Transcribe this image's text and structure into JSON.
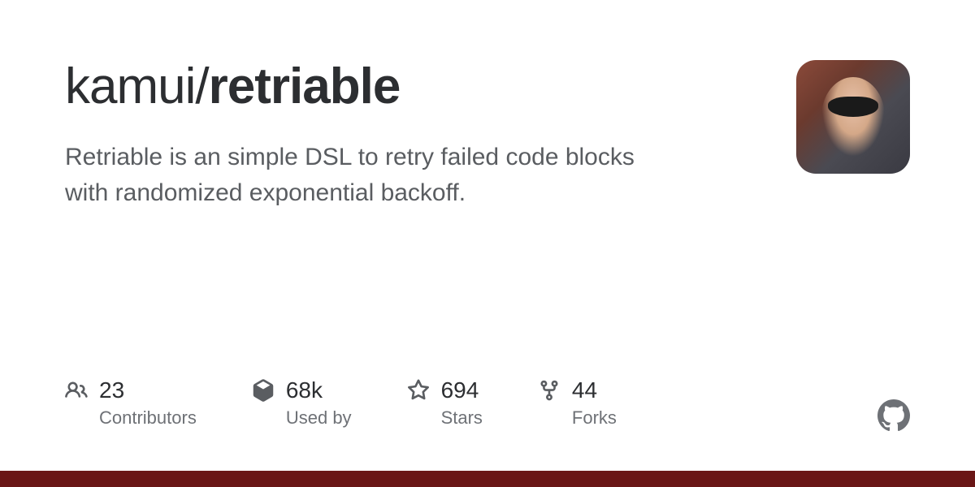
{
  "repo": {
    "owner": "kamui",
    "separator": "/",
    "name": "retriable",
    "description": "Retriable is an simple DSL to retry failed code blocks with randomized exponential backoff."
  },
  "stats": {
    "contributors": {
      "value": "23",
      "label": "Contributors"
    },
    "usedBy": {
      "value": "68k",
      "label": "Used by"
    },
    "stars": {
      "value": "694",
      "label": "Stars"
    },
    "forks": {
      "value": "44",
      "label": "Forks"
    }
  },
  "colors": {
    "accent": "#6a1616"
  }
}
